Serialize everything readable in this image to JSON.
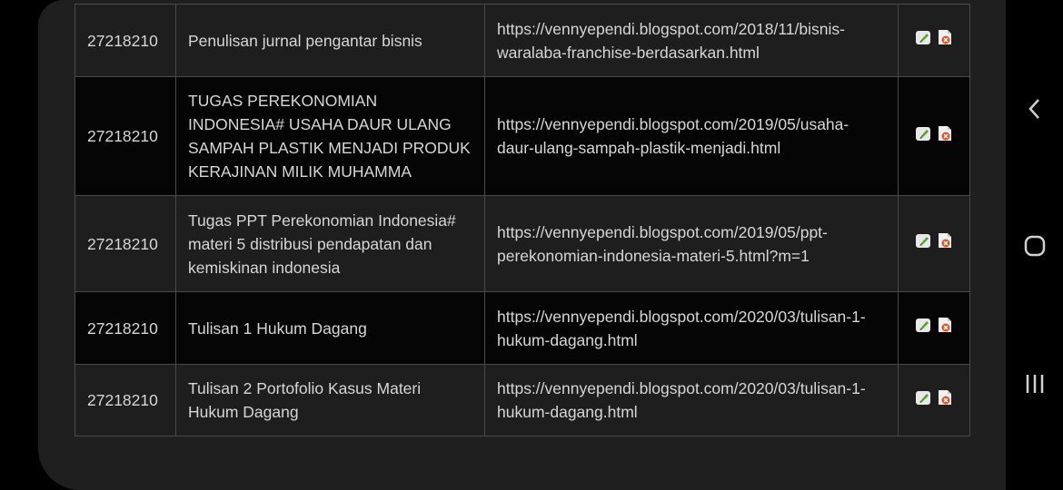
{
  "table": {
    "rows": [
      {
        "id": "27218210",
        "title": "Penulisan jurnal pengantar bisnis",
        "url": "https://vennyependi.blogspot.com/2018/11/bisnis-waralaba-franchise-berdasarkan.html",
        "height": 80,
        "shade": "light"
      },
      {
        "id": "27218210",
        "title": "TUGAS PEREKONOMIAN INDONESIA# USAHA DAUR ULANG SAMPAH PLASTIK MENJADI PRODUK KERAJINAN MILIK MUHAMMA",
        "url": "https://vennyependi.blogspot.com/2019/05/usaha-daur-ulang-sampah-plastik-menjadi.html",
        "height": 131,
        "shade": "dark"
      },
      {
        "id": "27218210",
        "title": "Tugas PPT Perekonomian Indonesia# materi 5 distribusi pendapatan dan kemiskinan indonesia",
        "url": "https://vennyependi.blogspot.com/2019/05/ppt-perekonomian-indonesia-materi-5.html?m=1",
        "height": 106,
        "shade": "light"
      },
      {
        "id": "27218210",
        "title": "Tulisan 1 Hukum Dagang",
        "url": "https://vennyependi.blogspot.com/2020/03/tulisan-1-hukum-dagang.html",
        "height": 80,
        "shade": "dark"
      },
      {
        "id": "27218210",
        "title": "Tulisan 2 Portofolio Kasus Materi Hukum Dagang",
        "url": "https://vennyependi.blogspot.com/2020/03/tulisan-1-hukum-dagang.html",
        "height": 79,
        "shade": "light"
      }
    ],
    "actions": {
      "edit_icon": "edit-icon",
      "delete_icon": "delete-icon"
    }
  },
  "system_nav": {
    "back_icon": "back-icon",
    "home_icon": "home-icon",
    "recents_icon": "recents-icon"
  }
}
